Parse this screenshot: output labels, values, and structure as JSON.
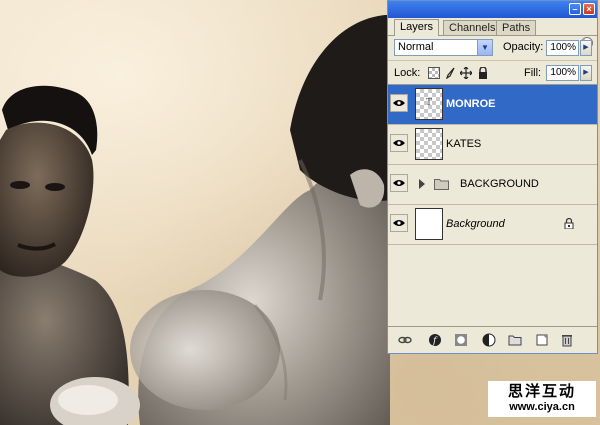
{
  "watermark": {
    "chinese": "思洋互动",
    "url": "www.ciya.cn"
  },
  "palette": {
    "tabs": [
      "Layers",
      "Channels",
      "Paths"
    ],
    "active_tab": "Layers",
    "blend_mode": "Normal",
    "opacity_label": "Opacity:",
    "opacity_value": "100%",
    "lock_label": "Lock:",
    "fill_label": "Fill:",
    "fill_value": "100%",
    "layers": [
      {
        "name": "MONROE",
        "type": "text",
        "selected": true,
        "visible": true,
        "thumb_text": "T"
      },
      {
        "name": "KATES",
        "type": "text",
        "selected": false,
        "visible": true
      },
      {
        "name": "BACKGROUND",
        "type": "group",
        "selected": false,
        "visible": true
      },
      {
        "name": "Background",
        "type": "background",
        "selected": false,
        "visible": true,
        "locked": true
      }
    ],
    "toolbar_icons": [
      "link-icon",
      "layer-style-icon",
      "layer-mask-icon",
      "adjustment-layer-icon",
      "new-group-icon",
      "new-layer-icon",
      "delete-layer-icon"
    ]
  },
  "colors": {
    "selection": "#3169c6",
    "titlebar": "#2356d2",
    "panel": "#ece9d8"
  }
}
